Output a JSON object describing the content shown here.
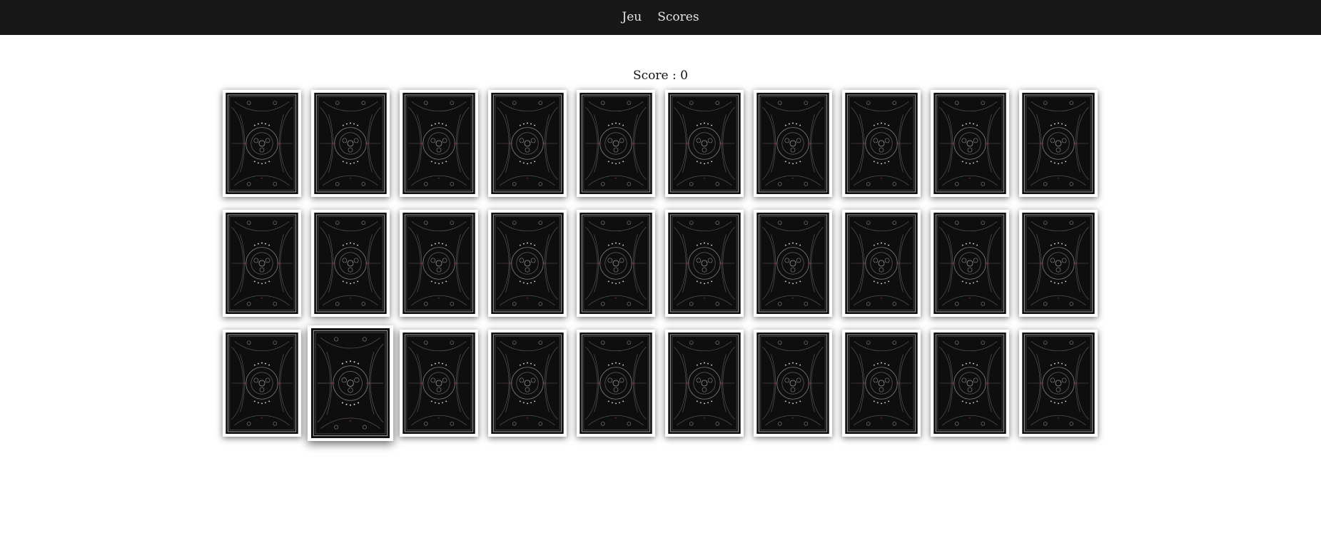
{
  "nav": {
    "items": [
      {
        "label": "Jeu"
      },
      {
        "label": "Scores"
      }
    ]
  },
  "game": {
    "score_text": "Score : 0",
    "rows": 3,
    "cols": 10,
    "cards_face_down": 30,
    "hovered_card": {
      "row": 3,
      "col": 2
    }
  },
  "colors": {
    "nav_bg": "#181818",
    "nav_text": "#e6e6e6",
    "card_back": "#0e0e0e",
    "card_pattern": "#9a9a9a",
    "card_accent": "#c0303a"
  }
}
